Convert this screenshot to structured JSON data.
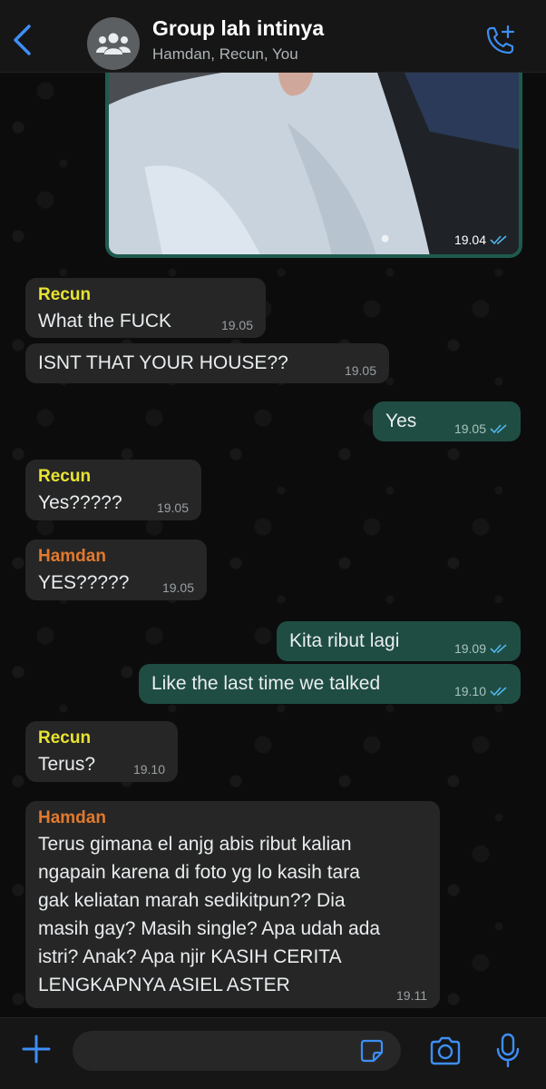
{
  "header": {
    "back_icon": "chevron-left-icon",
    "avatar_icon": "group-icon",
    "title": "Group lah intinya",
    "subtitle": "Hamdan, Recun, You",
    "call_icon": "add-call-icon"
  },
  "image_message": {
    "time": "19.04",
    "status": "read"
  },
  "messages": [
    {
      "sender": "Recun",
      "text": "What the FUCK",
      "time": "19.05"
    },
    {
      "text": "ISNT THAT YOUR HOUSE??",
      "time": "19.05"
    },
    {
      "text": "Yes",
      "time": "19.05",
      "status": "read"
    },
    {
      "sender": "Recun",
      "text": "Yes?????",
      "time": "19.05"
    },
    {
      "sender": "Hamdan",
      "text": "YES?????",
      "time": "19.05"
    },
    {
      "text": "Kita ribut lagi",
      "time": "19.09",
      "status": "read"
    },
    {
      "text": "Like the last time we talked",
      "time": "19.10",
      "status": "read"
    },
    {
      "sender": "Recun",
      "text": "Terus?",
      "time": "19.10"
    },
    {
      "sender": "Hamdan",
      "lines": [
        "Terus gimana el anjg abis ribut kalian",
        "ngapain karena di foto yg lo kasih tara",
        "gak keliatan marah sedikitpun?? Dia",
        "masih gay? Masih single? Apa udah ada",
        "istri? Anak? Apa njir KASIH CERITA",
        "LENGKAPNYA ASIEL ASTER"
      ],
      "time": "19.11"
    }
  ],
  "colors": {
    "accent": "#3d8ff5",
    "outgoing_bubble": "#1f4d43",
    "incoming_bubble": "#262626",
    "recun": "#e8e332",
    "hamdan": "#e17a2d"
  },
  "composer": {
    "value": "",
    "placeholder": "",
    "plus_icon": "plus-icon",
    "sticker_icon": "sticker-icon",
    "camera_icon": "camera-icon",
    "mic_icon": "microphone-icon"
  }
}
